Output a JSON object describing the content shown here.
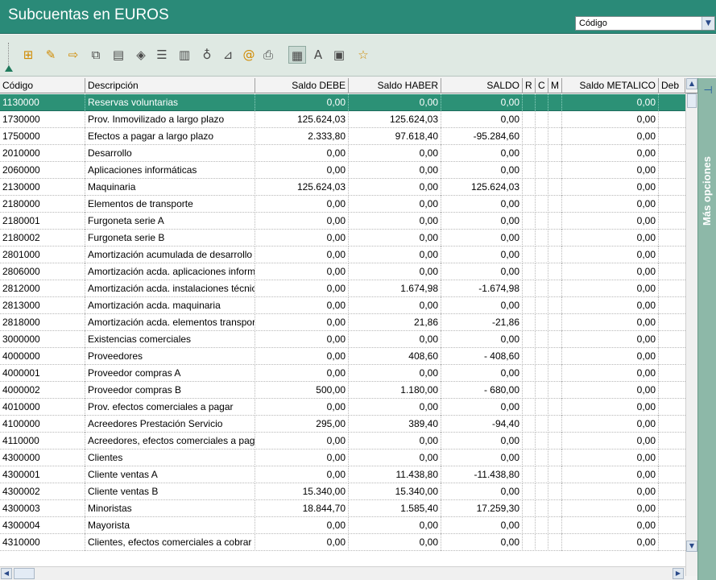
{
  "window": {
    "title": "Subcuentas en EUROS",
    "search_select_value": "Código",
    "side_panel_label": "Más opciones"
  },
  "toolbar": {
    "icons": [
      "add-record-icon",
      "edit-record-icon",
      "export-icon",
      "copy-icon",
      "clipboard-icon",
      "filter-icon",
      "list-icon",
      "columns-icon",
      "hint-icon",
      "eraser-icon",
      "at-icon",
      "print-icon",
      "view-icon",
      "font-icon",
      "memo-icon",
      "favorite-icon"
    ]
  },
  "table": {
    "headers": [
      "Código",
      "Descripción",
      "Saldo DEBE",
      "Saldo HABER",
      "SALDO",
      "R",
      "C",
      "M",
      "Saldo METALICO",
      "Deb"
    ],
    "rows": [
      [
        "1130000",
        "Reservas voluntarias",
        "0,00",
        "0,00",
        "0,00",
        "0,00"
      ],
      [
        "1730000",
        "Prov. Inmovilizado a largo plazo",
        "125.624,03",
        "125.624,03",
        "0,00",
        "0,00"
      ],
      [
        "1750000",
        "Efectos a pagar a largo plazo",
        "2.333,80",
        "97.618,40",
        "-95.284,60",
        "0,00"
      ],
      [
        "2010000",
        "Desarrollo",
        "0,00",
        "0,00",
        "0,00",
        "0,00"
      ],
      [
        "2060000",
        "Aplicaciones informáticas",
        "0,00",
        "0,00",
        "0,00",
        "0,00"
      ],
      [
        "2130000",
        "Maquinaria",
        "125.624,03",
        "0,00",
        "125.624,03",
        "0,00"
      ],
      [
        "2180000",
        "Elementos de transporte",
        "0,00",
        "0,00",
        "0,00",
        "0,00"
      ],
      [
        "2180001",
        "Furgoneta serie A",
        "0,00",
        "0,00",
        "0,00",
        "0,00"
      ],
      [
        "2180002",
        "Furgoneta serie B",
        "0,00",
        "0,00",
        "0,00",
        "0,00"
      ],
      [
        "2801000",
        "Amortización acumulada de desarrollo",
        "0,00",
        "0,00",
        "0,00",
        "0,00"
      ],
      [
        "2806000",
        "Amortización acda. aplicaciones informáticas",
        "0,00",
        "0,00",
        "0,00",
        "0,00"
      ],
      [
        "2812000",
        "Amortización acda. instalaciones técnicas",
        "0,00",
        "1.674,98",
        "-1.674,98",
        "0,00"
      ],
      [
        "2813000",
        "Amortización acda. maquinaria",
        "0,00",
        "0,00",
        "0,00",
        "0,00"
      ],
      [
        "2818000",
        "Amortización acda. elementos transporte",
        "0,00",
        "21,86",
        "-21,86",
        "0,00"
      ],
      [
        "3000000",
        "Existencias comerciales",
        "0,00",
        "0,00",
        "0,00",
        "0,00"
      ],
      [
        "4000000",
        "Proveedores",
        "0,00",
        "408,60",
        "- 408,60",
        "0,00"
      ],
      [
        "4000001",
        "Proveedor compras A",
        "0,00",
        "0,00",
        "0,00",
        "0,00"
      ],
      [
        "4000002",
        "Proveedor compras B",
        "500,00",
        "1.180,00",
        "- 680,00",
        "0,00"
      ],
      [
        "4010000",
        "Prov. efectos comerciales a pagar",
        "0,00",
        "0,00",
        "0,00",
        "0,00"
      ],
      [
        "4100000",
        "Acreedores Prestación Servicio",
        "295,00",
        "389,40",
        "-94,40",
        "0,00"
      ],
      [
        "4110000",
        "Acreedores, efectos comerciales a pagar",
        "0,00",
        "0,00",
        "0,00",
        "0,00"
      ],
      [
        "4300000",
        "Clientes",
        "0,00",
        "0,00",
        "0,00",
        "0,00"
      ],
      [
        "4300001",
        "Cliente ventas A",
        "0,00",
        "11.438,80",
        "-11.438,80",
        "0,00"
      ],
      [
        "4300002",
        "Cliente ventas B",
        "15.340,00",
        "15.340,00",
        "0,00",
        "0,00"
      ],
      [
        "4300003",
        "Minoristas",
        "18.844,70",
        "1.585,40",
        "17.259,30",
        "0,00"
      ],
      [
        "4300004",
        "Mayorista",
        "0,00",
        "0,00",
        "0,00",
        "0,00"
      ],
      [
        "4310000",
        "Clientes, efectos comerciales a cobrar",
        "0,00",
        "0,00",
        "0,00",
        "0,00"
      ]
    ]
  },
  "colors": {
    "title_bar": "#2a8a78",
    "selection": "#2c9176",
    "side_panel": "#8db8a8"
  }
}
